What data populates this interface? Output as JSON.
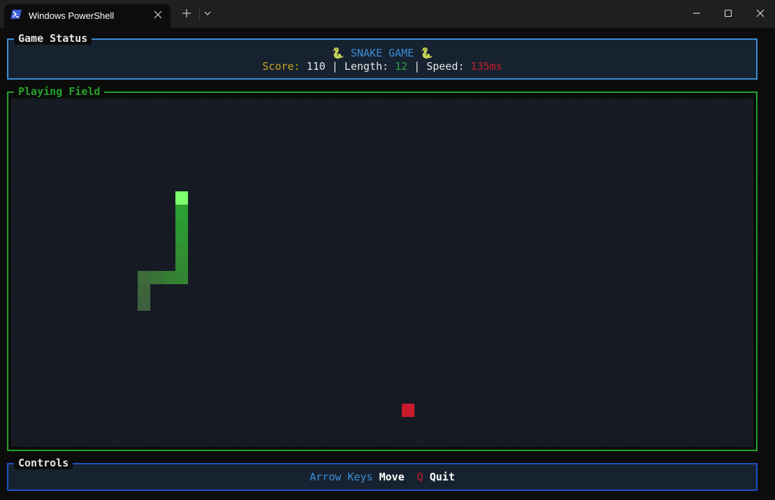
{
  "window": {
    "tab_title": "Windows PowerShell"
  },
  "status_panel": {
    "title": "Game Status",
    "game_title": "SNAKE GAME",
    "score_label": "Score:",
    "score_value": "110",
    "separator": "|",
    "length_label": "Length:",
    "length_value": "12",
    "speed_label": "Speed:",
    "speed_value": "135ms"
  },
  "field_panel": {
    "title": "Playing Field"
  },
  "controls_panel": {
    "title": "Controls",
    "arrow_key": "Arrow Keys",
    "move_action": "Move",
    "quit_key": "Q",
    "quit_action": "Quit"
  },
  "game": {
    "snake_segments": [
      {
        "col": 13,
        "row": 7,
        "color": "#7dff6e"
      },
      {
        "col": 13,
        "row": 8,
        "color": "#2c9f33"
      },
      {
        "col": 13,
        "row": 9,
        "color": "#2c9a33"
      },
      {
        "col": 13,
        "row": 10,
        "color": "#2d9532"
      },
      {
        "col": 13,
        "row": 11,
        "color": "#2f8f32"
      },
      {
        "col": 13,
        "row": 12,
        "color": "#318a32"
      },
      {
        "col": 13,
        "row": 13,
        "color": "#338432"
      },
      {
        "col": 12,
        "row": 13,
        "color": "#367d34"
      },
      {
        "col": 11,
        "row": 13,
        "color": "#397336"
      },
      {
        "col": 10,
        "row": 13,
        "color": "#3d6b3a"
      },
      {
        "col": 10,
        "row": 14,
        "color": "#3e643c"
      },
      {
        "col": 10,
        "row": 15,
        "color": "#3e5f3d"
      }
    ],
    "food": {
      "col": 31,
      "row": 23,
      "color": "#c91b2b"
    }
  }
}
